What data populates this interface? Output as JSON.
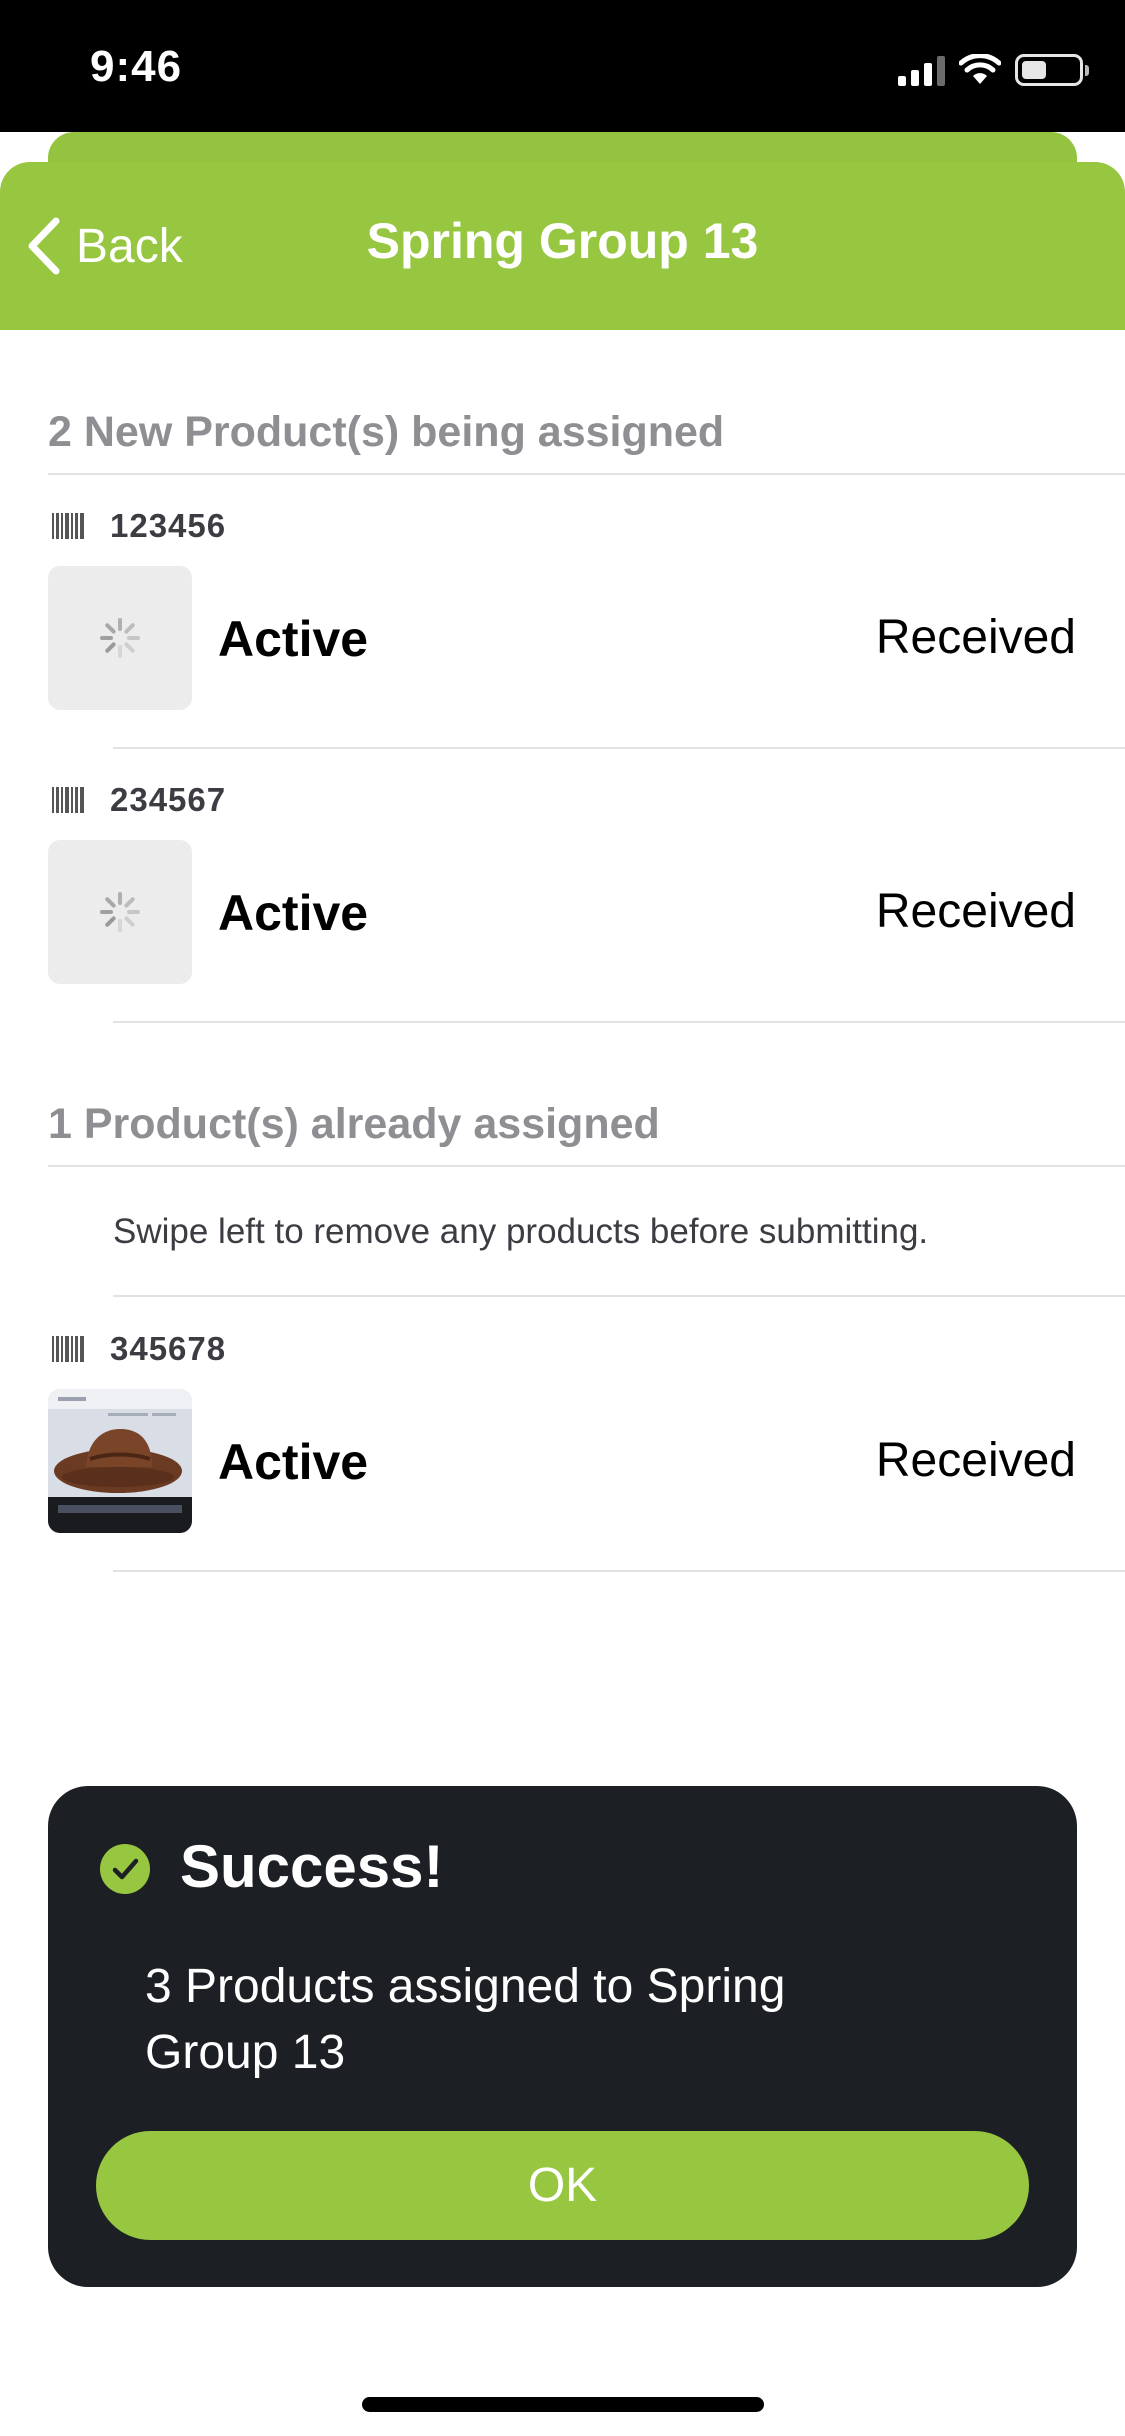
{
  "status_bar": {
    "time": "9:46"
  },
  "nav": {
    "back_label": "Back",
    "title": "Spring Group 13"
  },
  "sections": {
    "new_header": "2 New Product(s) being assigned",
    "assigned_header": "1 Product(s) already assigned",
    "swipe_note": "Swipe left to remove any products before submitting."
  },
  "products": [
    {
      "barcode": "123456",
      "status": "Active",
      "state": "Received",
      "image": "loading-spinner"
    },
    {
      "barcode": "234567",
      "status": "Active",
      "state": "Received",
      "image": "loading-spinner"
    },
    {
      "barcode": "345678",
      "status": "Active",
      "state": "Received",
      "image": "hat-photo"
    }
  ],
  "toast": {
    "title": "Success!",
    "message": "3 Products assigned to Spring Group 13",
    "ok_label": "OK"
  },
  "colors": {
    "accent_green": "#97c640",
    "toast_background": "#1c1f23",
    "section_header_gray": "#8e8e93"
  }
}
